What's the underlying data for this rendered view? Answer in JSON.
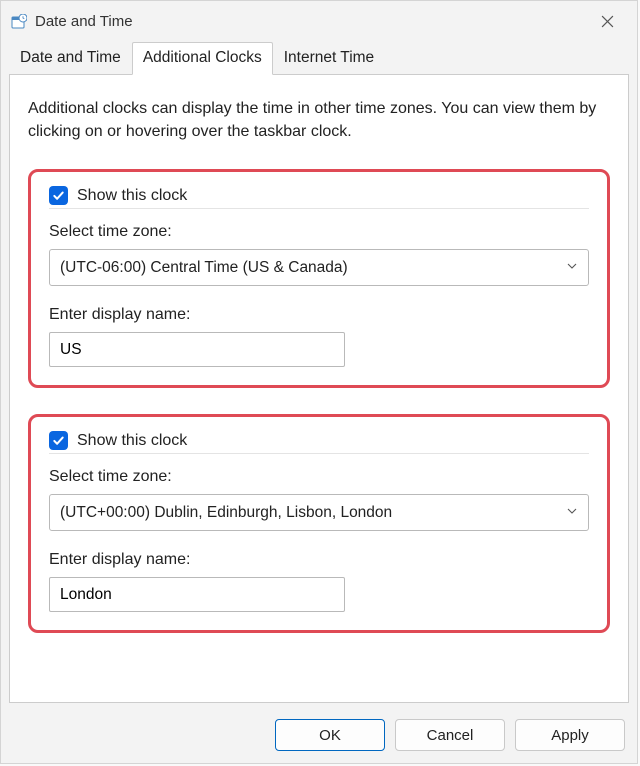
{
  "window": {
    "title": "Date and Time"
  },
  "tabs": {
    "items": [
      {
        "label": "Date and Time"
      },
      {
        "label": "Additional Clocks"
      },
      {
        "label": "Internet Time"
      }
    ],
    "activeIndex": 1
  },
  "panel": {
    "intro": "Additional clocks can display the time in other time zones. You can view them by clicking on or hovering over the taskbar clock.",
    "clocks": [
      {
        "show_label": "Show this clock",
        "checked": true,
        "tz_label": "Select time zone:",
        "tz_value": "(UTC-06:00) Central Time (US & Canada)",
        "name_label": "Enter display name:",
        "name_value": "US"
      },
      {
        "show_label": "Show this clock",
        "checked": true,
        "tz_label": "Select time zone:",
        "tz_value": "(UTC+00:00) Dublin, Edinburgh, Lisbon, London",
        "name_label": "Enter display name:",
        "name_value": "London"
      }
    ]
  },
  "buttons": {
    "ok": "OK",
    "cancel": "Cancel",
    "apply": "Apply"
  }
}
